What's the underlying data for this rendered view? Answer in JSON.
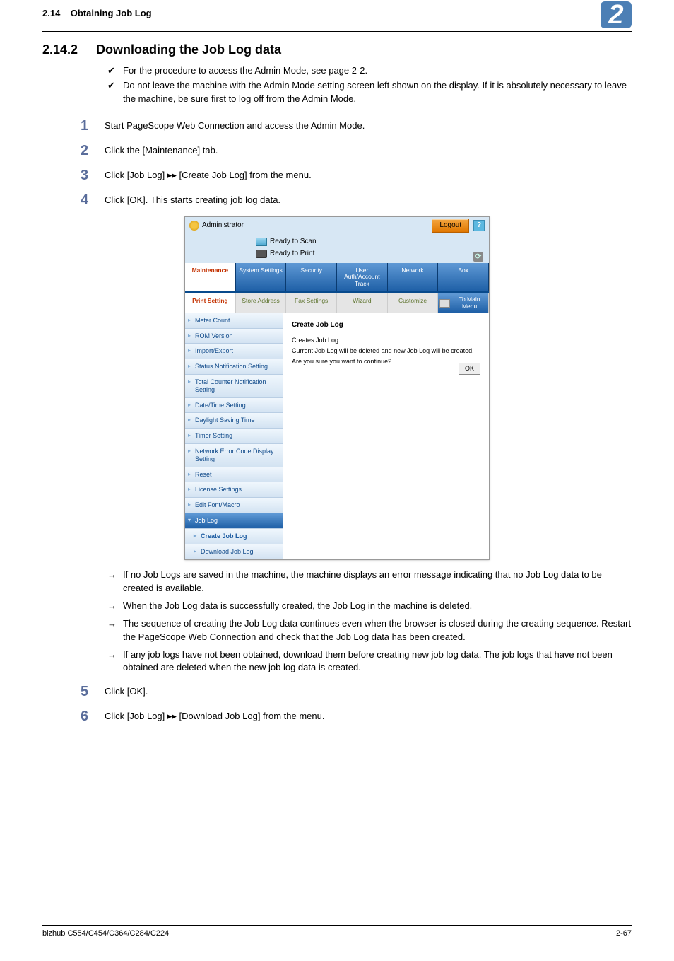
{
  "header": {
    "section_ref": "2.14",
    "section_label": "Obtaining Job Log",
    "chapter_badge": "2"
  },
  "section": {
    "number": "2.14.2",
    "title": "Downloading the Job Log data"
  },
  "bullets": {
    "b1": "For the procedure to access the Admin Mode, see page 2-2.",
    "b2": "Do not leave the machine with the Admin Mode setting screen left shown on the display. If it is absolutely necessary to leave the machine, be sure first to log off from the Admin Mode."
  },
  "steps": {
    "s1n": "1",
    "s1": "Start PageScope Web Connection and access the Admin Mode.",
    "s2n": "2",
    "s2": "Click the [Maintenance] tab.",
    "s3n": "3",
    "s3": "Click [Job Log] ▸▸ [Create Job Log] from the menu.",
    "s4n": "4",
    "s4": "Click [OK]. This starts creating job log data.",
    "s5n": "5",
    "s5": "Click [OK].",
    "s6n": "6",
    "s6": "Click [Job Log] ▸▸ [Download Job Log] from the menu."
  },
  "arrows": {
    "a1": "If no Job Logs are saved in the machine, the machine displays an error message indicating that no Job Log data to be created is available.",
    "a2": "When the Job Log data is successfully created, the Job Log in the machine is deleted.",
    "a3": "The sequence of creating the Job Log data continues even when the browser is closed during the creating sequence. Restart the PageScope Web Connection and check that the Job Log data has been created.",
    "a4": "If any job logs have not been obtained, download them before creating new job log data. The job logs that have not been obtained are deleted when the new job log data is created."
  },
  "shot": {
    "admin_label": "Administrator",
    "logout": "Logout",
    "help": "?",
    "ready_scan": "Ready to Scan",
    "ready_print": "Ready to Print",
    "refresh_glyph": "⟳",
    "tabs": {
      "maintenance": "Maintenance",
      "system": "System Settings",
      "security": "Security",
      "user": "User Auth/Account Track",
      "network": "Network",
      "box": "Box"
    },
    "subtabs": {
      "print": "Print Setting",
      "store": "Store Address",
      "fax": "Fax Settings",
      "wizard": "Wizard",
      "customize": "Customize",
      "tomain": "To Main Menu"
    },
    "side": {
      "meter": "Meter Count",
      "rom": "ROM Version",
      "import": "Import/Export",
      "status": "Status Notification Setting",
      "total": "Total Counter Notification Setting",
      "datetime": "Date/Time Setting",
      "daylight": "Daylight Saving Time",
      "timer": "Timer Setting",
      "neterr": "Network Error Code Display Setting",
      "reset": "Reset",
      "license": "License Settings",
      "editfont": "Edit Font/Macro",
      "joblog": "Job Log",
      "create": "Create Job Log",
      "download": "Download Job Log"
    },
    "content": {
      "title": "Create Job Log",
      "line1": "Creates Job Log.",
      "line2": "Current Job Log will be deleted and new Job Log will be created.",
      "line3": "Are you sure you want to continue?",
      "ok": "OK"
    }
  },
  "footer": {
    "model": "bizhub C554/C454/C364/C284/C224",
    "page": "2-67"
  }
}
